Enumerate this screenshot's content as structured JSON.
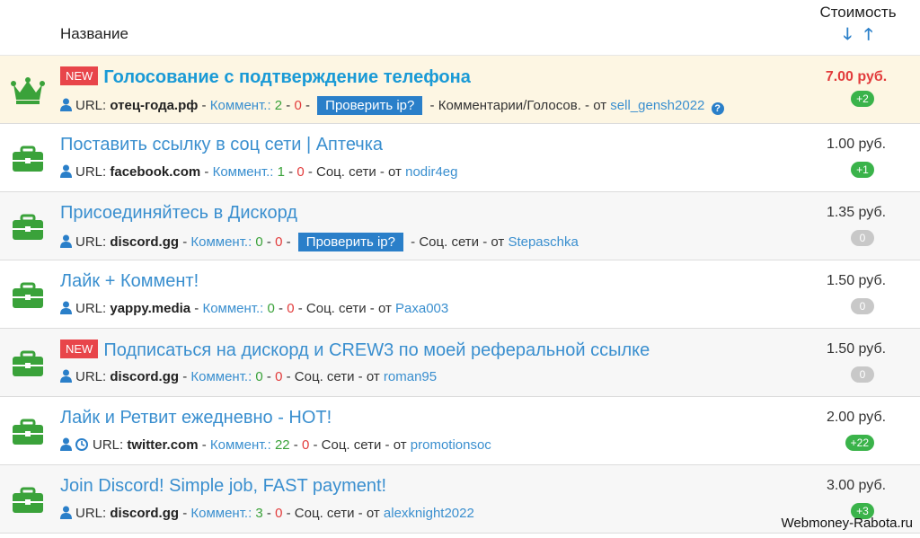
{
  "header": {
    "name_label": "Название",
    "cost_label": "Стоимость",
    "sort_down": "🡓",
    "sort_up": "🡑"
  },
  "colors": {
    "accent": "#3a8fcf",
    "featured_bg": "#fdf6e3",
    "new_badge": "#e8454a",
    "briefcase": "#3aa23a"
  },
  "rows": [
    {
      "icon": "crown-icon",
      "new": "NEW",
      "title": "Голосование с подтверждение телефона",
      "url_label": "URL:",
      "url": "отец-года.рф",
      "comments_label": "Коммент.:",
      "comments_pos": "2",
      "comments_neg": "0",
      "check_label": "Проверить ip?",
      "category": "Комментарии/Голосов.",
      "from_label": "от",
      "user": "sell_gensh2022",
      "help": "?",
      "price": "7.00 руб.",
      "badge": "+2"
    },
    {
      "icon": "briefcase-icon",
      "title": "Поставить ссылку в соц сети | Аптечка",
      "url_label": "URL:",
      "url": "facebook.com",
      "comments_label": "Коммент.:",
      "comments_pos": "1",
      "comments_neg": "0",
      "category": "Соц. сети",
      "from_label": "от",
      "user": "nodir4eg",
      "price": "1.00 руб.",
      "badge": "+1"
    },
    {
      "icon": "briefcase-icon",
      "title": "Присоединяйтесь в Дискорд",
      "url_label": "URL:",
      "url": "discord.gg",
      "comments_label": "Коммент.:",
      "comments_pos": "0",
      "comments_neg": "0",
      "check_label": "Проверить ip?",
      "category": "Соц. сети",
      "from_label": "от",
      "user": "Stepaschka",
      "price": "1.35 руб.",
      "badge": "0"
    },
    {
      "icon": "briefcase-icon",
      "title": "Лайк + Коммент!",
      "url_label": "URL:",
      "url": "yappy.media",
      "comments_label": "Коммент.:",
      "comments_pos": "0",
      "comments_neg": "0",
      "category": "Соц. сети",
      "from_label": "от",
      "user": "Paxa003",
      "price": "1.50 руб.",
      "badge": "0"
    },
    {
      "icon": "briefcase-icon",
      "new": "NEW",
      "title": "Подписаться на дискорд и CREW3 по моей реферальной ссылке",
      "url_label": "URL:",
      "url": "discord.gg",
      "comments_label": "Коммент.:",
      "comments_pos": "0",
      "comments_neg": "0",
      "category": "Соц. сети",
      "from_label": "от",
      "user": "roman95",
      "price": "1.50 руб.",
      "badge": "0"
    },
    {
      "icon": "briefcase-icon",
      "title": "Лайк и Ретвит ежедневно - HOT!",
      "url_label": "URL:",
      "url": "twitter.com",
      "comments_label": "Коммент.:",
      "comments_pos": "22",
      "comments_neg": "0",
      "category": "Соц. сети",
      "from_label": "от",
      "user": "promotionsoc",
      "price": "2.00 руб.",
      "badge": "+22"
    },
    {
      "icon": "briefcase-icon",
      "title": "Join Discord! Simple job, FAST payment!",
      "url_label": "URL:",
      "url": "discord.gg",
      "comments_label": "Коммент.:",
      "comments_pos": "3",
      "comments_neg": "0",
      "category": "Соц. сети",
      "from_label": "от",
      "user": "alexknight2022",
      "price": "3.00 руб.",
      "badge": "+3"
    }
  ],
  "watermark": "Webmoney-Rabota.ru"
}
